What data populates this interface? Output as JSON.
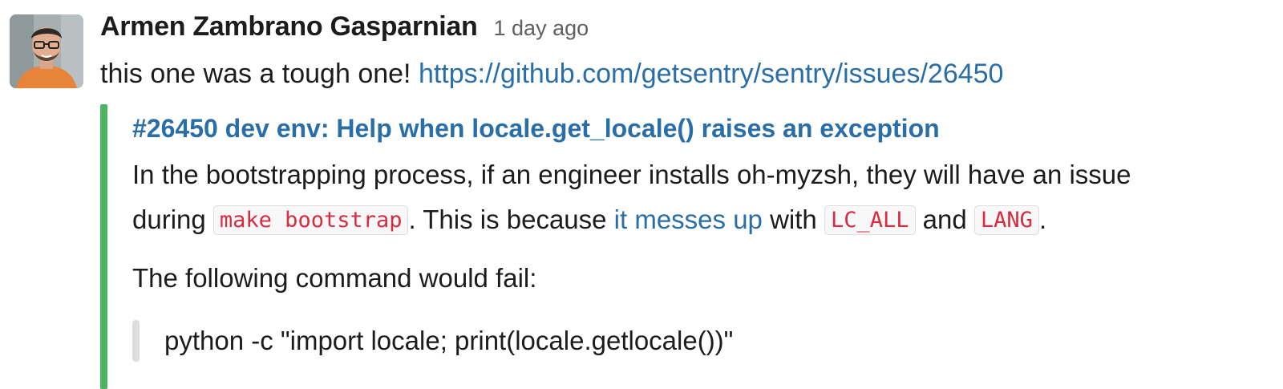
{
  "message": {
    "avatar_icon": "user-avatar-photo",
    "sender": "Armen Zambrano Gasparnian",
    "timestamp": "1 day ago",
    "text": "this one was a tough one! ",
    "link": "https://github.com/getsentry/sentry/issues/26450"
  },
  "attachment": {
    "bar_color": "#4bb562",
    "title": "#26450 dev env: Help when locale.get_locale() raises an exception",
    "desc_line1": "In the bootstrapping process, if an engineer installs oh-myzsh, they will have an issue",
    "desc_line2_start": "during ",
    "code1": "make bootstrap",
    "desc_line2_mid": ". This is because ",
    "inline_link": "it messes up",
    "desc_line2_with": " with ",
    "code2": "LC_ALL",
    "desc_line2_and": " and ",
    "code3": "LANG",
    "desc_line2_end": ".",
    "para2": "The following command would fail:",
    "command": "python -c \"import locale; print(locale.getlocale())\""
  },
  "colors": {
    "link": "#2a6ea8",
    "code_text": "#d72b3f"
  }
}
